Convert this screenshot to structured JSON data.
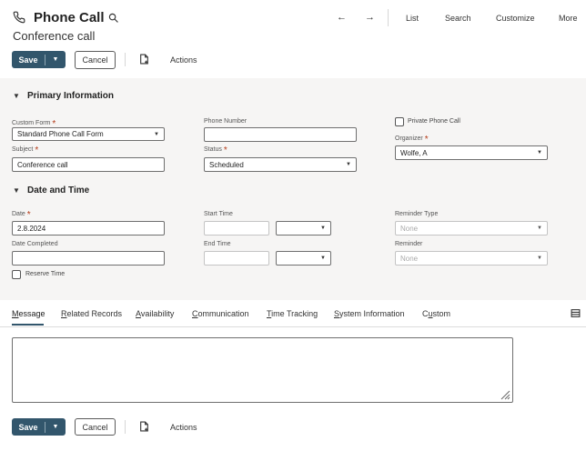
{
  "header": {
    "title": "Phone Call",
    "subtitle": "Conference call",
    "nav": {
      "back_arrow": "←",
      "forward_arrow": "→",
      "list": "List",
      "search": "Search",
      "customize": "Customize",
      "more": "More"
    }
  },
  "toolbar": {
    "save_label": "Save",
    "cancel_label": "Cancel",
    "actions_label": "Actions"
  },
  "primary_information": {
    "section_title": "Primary Information",
    "custom_form": {
      "label": "Custom Form",
      "value": "Standard Phone Call Form"
    },
    "phone_number": {
      "label": "Phone Number",
      "value": ""
    },
    "private_phone_call": {
      "label": "Private Phone Call",
      "checked": false
    },
    "subject": {
      "label": "Subject",
      "value": "Conference call"
    },
    "status": {
      "label": "Status",
      "value": "Scheduled"
    },
    "organizer": {
      "label": "Organizer",
      "value": "Wolfe, A"
    }
  },
  "date_and_time": {
    "section_title": "Date and Time",
    "date": {
      "label": "Date",
      "value": "2.8.2024"
    },
    "start_time": {
      "label": "Start Time",
      "value": ""
    },
    "reminder_type": {
      "label": "Reminder Type",
      "value": "None"
    },
    "date_completed": {
      "label": "Date Completed",
      "value": ""
    },
    "end_time": {
      "label": "End Time",
      "value": ""
    },
    "reminder": {
      "label": "Reminder",
      "value": "None"
    },
    "reserve_time": {
      "label": "Reserve Time",
      "checked": false
    }
  },
  "subtabs": [
    {
      "label": "Message",
      "underline_char": "M",
      "rest": "essage",
      "active": true
    },
    {
      "label": "Related Records",
      "underline_char": "R",
      "rest": "elated Records",
      "active": false
    },
    {
      "label": "Availability",
      "underline_char": "A",
      "rest": "vailability",
      "active": false
    },
    {
      "label": "Communication",
      "underline_char": "C",
      "rest": "ommunication",
      "active": false
    },
    {
      "label": "Time Tracking",
      "underline_char": "T",
      "rest": "ime Tracking",
      "active": false
    },
    {
      "label": "System Information",
      "underline_char": "S",
      "rest": "ystem Information",
      "active": false
    },
    {
      "label": "Custom",
      "underline_char": "u",
      "pre": "C",
      "rest": "stom",
      "active": false
    }
  ],
  "message": {
    "value": ""
  },
  "footer_toolbar": {
    "save_label": "Save",
    "cancel_label": "Cancel",
    "actions_label": "Actions"
  },
  "colors": {
    "primary_button": "#32566c",
    "required_marker": "#b53b19",
    "panel_background": "#f6f5f4"
  },
  "icons": {
    "record_type": "phone-icon",
    "search": "search-icon",
    "new_record": "new-document-icon",
    "layout": "layout-icon"
  }
}
